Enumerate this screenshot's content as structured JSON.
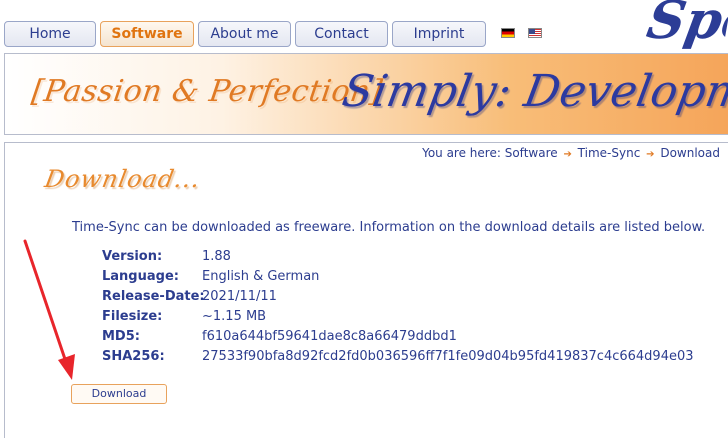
{
  "nav": {
    "tabs": [
      {
        "label": "Home"
      },
      {
        "label": "Software"
      },
      {
        "label": "About me"
      },
      {
        "label": "Contact"
      },
      {
        "label": "Imprint"
      }
    ],
    "active_tab": "Software",
    "corner_logo": "Spe"
  },
  "banner": {
    "slogan": "[Passion & Perfection]",
    "brand": "Simply: Development"
  },
  "breadcrumb": {
    "prefix": "You are here:",
    "items": [
      "Software",
      "Time-Sync",
      "Download"
    ]
  },
  "page": {
    "heading": "Download...",
    "intro": "Time-Sync can be downloaded as freeware. Information on the download details are listed below."
  },
  "details": [
    {
      "label": "Version:",
      "value": "1.88"
    },
    {
      "label": "Language:",
      "value": "English & German"
    },
    {
      "label": "Release-Date:",
      "value": "2021/11/11"
    },
    {
      "label": "Filesize:",
      "value": "~1.15 MB"
    },
    {
      "label": "MD5:",
      "value": "f610a644bf59641dae8c8a66479ddbd1"
    },
    {
      "label": "SHA256:",
      "value": "27533f90bfa8d92fcd2fd0b036596ff7f1fe09d04b95fd419837c4c664d94e03"
    }
  ],
  "download_button": {
    "label": "Download"
  },
  "colors": {
    "accent": "#e07a24",
    "text": "#2c3d8f",
    "annotation_arrow": "#e8252b"
  }
}
